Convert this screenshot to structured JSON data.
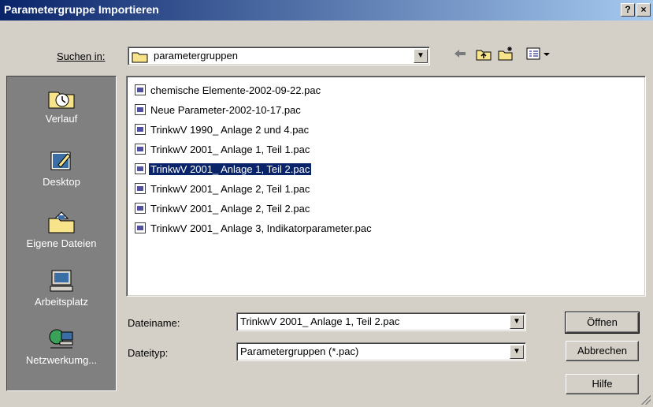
{
  "window": {
    "title": "Parametergruppe Importieren",
    "help_button": "?",
    "close_button": "×"
  },
  "lookin": {
    "label": "Suchen in:",
    "value": "parametergruppen"
  },
  "places": [
    {
      "label": "Verlauf",
      "icon": "history-icon"
    },
    {
      "label": "Desktop",
      "icon": "desktop-icon"
    },
    {
      "label": "Eigene Dateien",
      "icon": "my-documents-icon"
    },
    {
      "label": "Arbeitsplatz",
      "icon": "my-computer-icon"
    },
    {
      "label": "Netzwerkumg...",
      "icon": "network-icon"
    }
  ],
  "files": [
    "chemische Elemente-2002-09-22.pac",
    "Neue Parameter-2002-10-17.pac",
    "TrinkwV 1990_ Anlage 2 und 4.pac",
    "TrinkwV 2001_ Anlage 1, Teil 1.pac",
    "TrinkwV 2001_ Anlage 1, Teil 2.pac",
    "TrinkwV 2001_ Anlage 2, Teil 1.pac",
    "TrinkwV 2001_ Anlage 2, Teil 2.pac",
    "TrinkwV 2001_ Anlage 3, Indikatorparameter.pac"
  ],
  "selected_file_index": 4,
  "filename": {
    "label": "Dateiname:",
    "value": "TrinkwV 2001_ Anlage 1, Teil 2.pac"
  },
  "filetype": {
    "label": "Dateityp:",
    "value": "Parametergruppen (*.pac)"
  },
  "buttons": {
    "open": "Öffnen",
    "cancel": "Abbrechen",
    "help": "Hilfe"
  },
  "colors": {
    "title_bar": "#0a246a",
    "selection": "#0a246a",
    "dialog_bg": "#d4d0c8",
    "places_bg": "#808080"
  }
}
